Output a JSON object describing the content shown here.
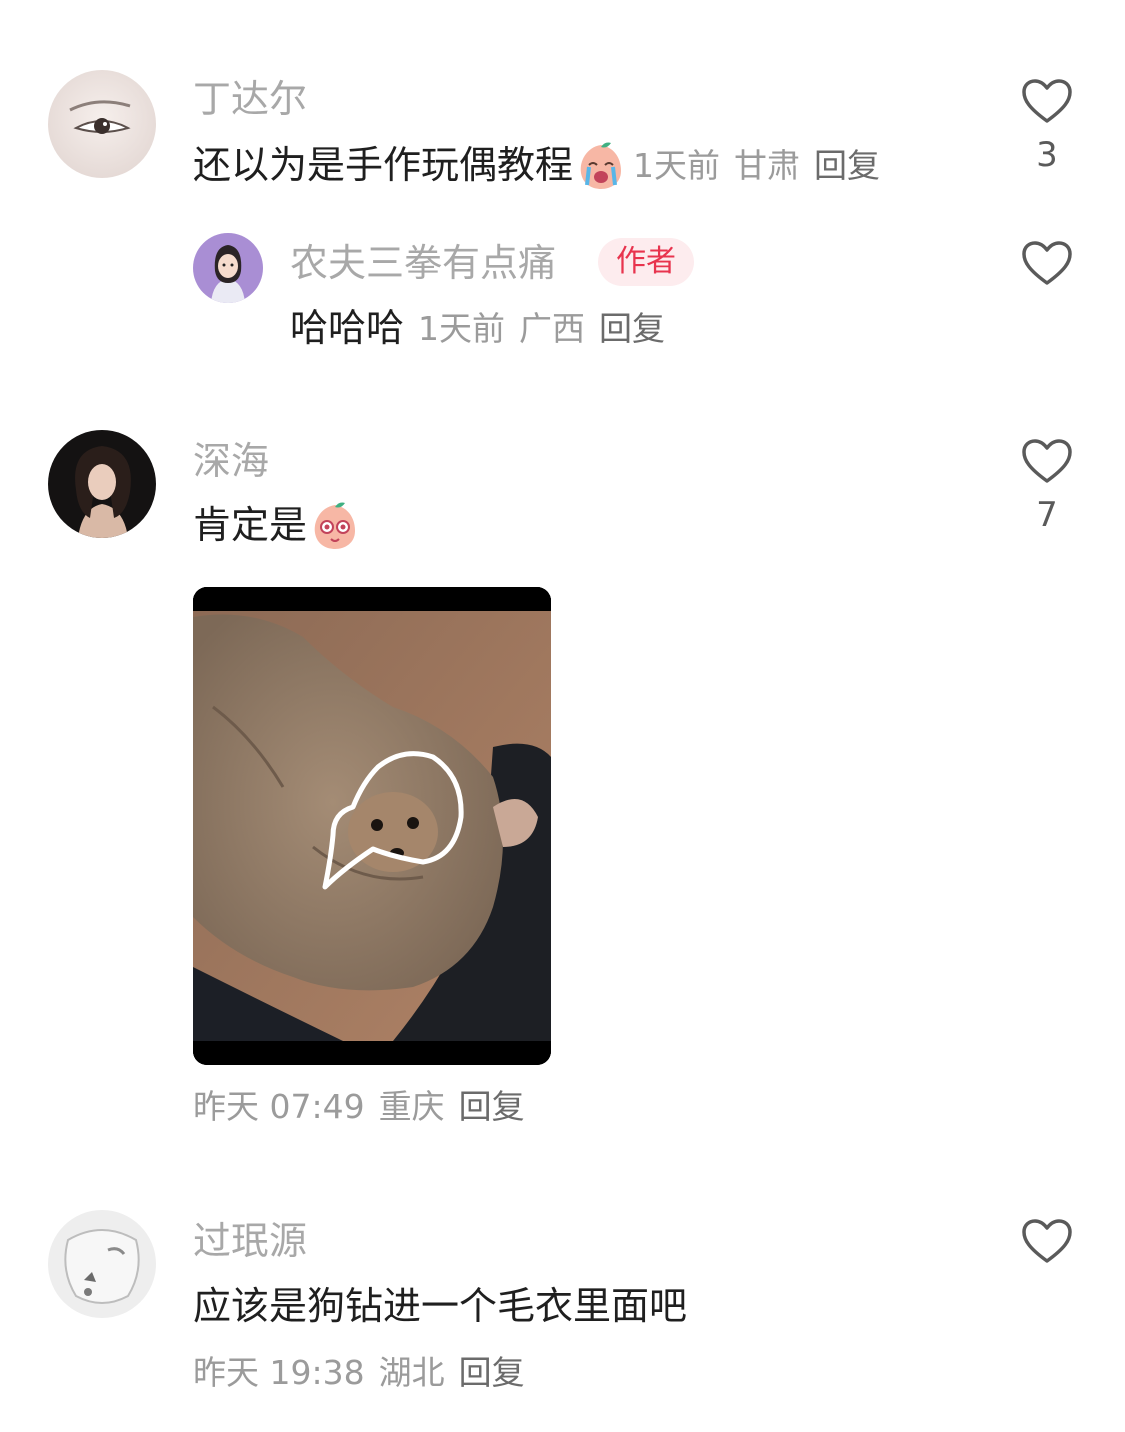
{
  "comments": [
    {
      "username": "丁达尔",
      "text": "还以为是手作玩偶教程",
      "emoji": "crying-peach-emoji",
      "time": "1天前",
      "location": "甘肃",
      "reply_label": "回复",
      "likes": "3",
      "replies": [
        {
          "username": "农夫三拳有点痛",
          "badge": "作者",
          "text": "哈哈哈",
          "time": "1天前",
          "location": "广西",
          "reply_label": "回复",
          "likes": ""
        }
      ]
    },
    {
      "username": "深海",
      "text": "肯定是",
      "emoji": "shy-peach-emoji",
      "image": "photo-dog-in-sweater",
      "time": "昨天 07:49",
      "location": "重庆",
      "reply_label": "回复",
      "likes": "7"
    },
    {
      "username": "过珉源",
      "text": "应该是狗钻进一个毛衣里面吧",
      "time": "昨天 19:38",
      "location": "湖北",
      "reply_label": "回复",
      "likes": ""
    }
  ],
  "colors": {
    "username": "#a8a8a8",
    "content": "#1f1f1f",
    "meta": "#9b9b9b",
    "badge_bg": "#fdecee",
    "badge_text": "#e8344e",
    "icon_stroke": "#5a5a5a"
  }
}
